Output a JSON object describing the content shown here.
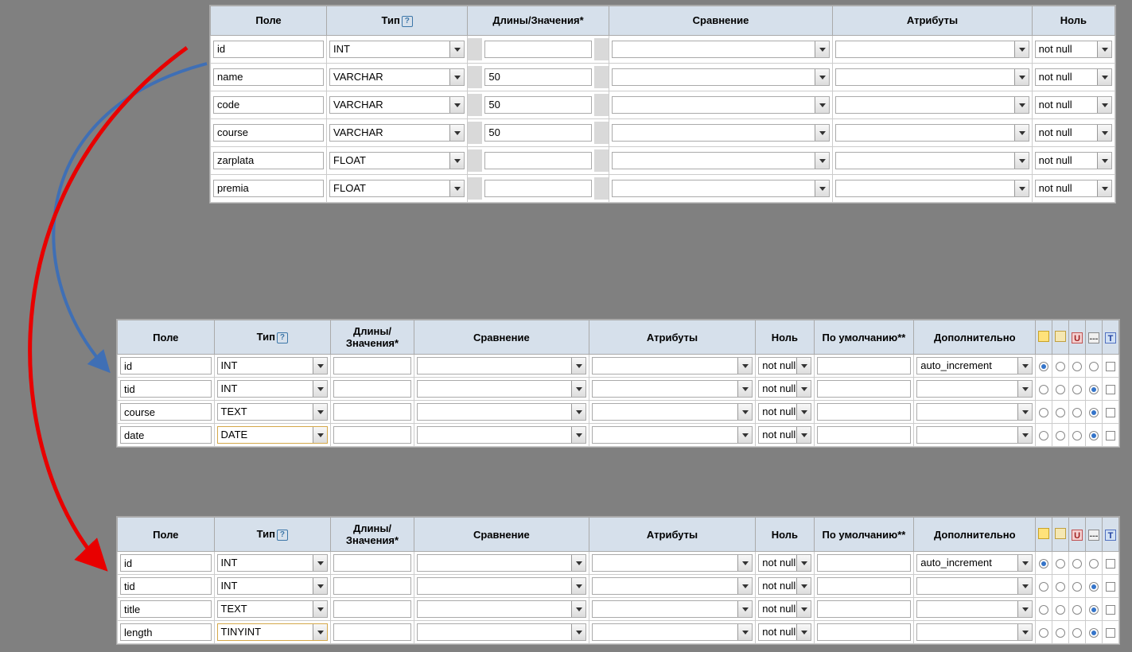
{
  "headers": {
    "pole": "Поле",
    "type": "Тип",
    "len": "Длины/Значения*",
    "len_short": "Длины/\nЗначения*",
    "coll": "Сравнение",
    "attr": "Атрибуты",
    "null": "Ноль",
    "default": "По умолчанию**",
    "extra": "Дополнительно"
  },
  "table1": {
    "rows": [
      {
        "pole": "id",
        "type": "INT",
        "len": "",
        "null": "not null"
      },
      {
        "pole": "name",
        "type": "VARCHAR",
        "len": "50",
        "null": "not null"
      },
      {
        "pole": "code",
        "type": "VARCHAR",
        "len": "50",
        "null": "not null"
      },
      {
        "pole": "course",
        "type": "VARCHAR",
        "len": "50",
        "null": "not null"
      },
      {
        "pole": "zarplata",
        "type": "FLOAT",
        "len": "",
        "null": "not null"
      },
      {
        "pole": "premia",
        "type": "FLOAT",
        "len": "",
        "null": "not null"
      }
    ]
  },
  "table2": {
    "rows": [
      {
        "pole": "id",
        "type": "INT",
        "null": "not null",
        "extra": "auto_increment",
        "radio": 0,
        "hl": false
      },
      {
        "pole": "tid",
        "type": "INT",
        "null": "not null",
        "extra": "",
        "radio": 3,
        "hl": false
      },
      {
        "pole": "course",
        "type": "TEXT",
        "null": "not null",
        "extra": "",
        "radio": 3,
        "hl": false
      },
      {
        "pole": "date",
        "type": "DATE",
        "null": "not null",
        "extra": "",
        "radio": 3,
        "hl": true
      }
    ]
  },
  "table3": {
    "rows": [
      {
        "pole": "id",
        "type": "INT",
        "null": "not null",
        "extra": "auto_increment",
        "radio": 0,
        "hl": false
      },
      {
        "pole": "tid",
        "type": "INT",
        "null": "not null",
        "extra": "",
        "radio": 3,
        "hl": false
      },
      {
        "pole": "title",
        "type": "TEXT",
        "null": "not null",
        "extra": "",
        "radio": 3,
        "hl": false
      },
      {
        "pole": "length",
        "type": "TINYINT",
        "null": "not null",
        "extra": "",
        "radio": 3,
        "hl": true
      }
    ]
  },
  "icon_headers": [
    "key",
    "idx",
    "uni",
    "dash",
    "ft"
  ],
  "icon_glyphs": {
    "key": "🔑",
    "idx": "✎",
    "uni": "U",
    "dash": "---",
    "ft": "T"
  }
}
